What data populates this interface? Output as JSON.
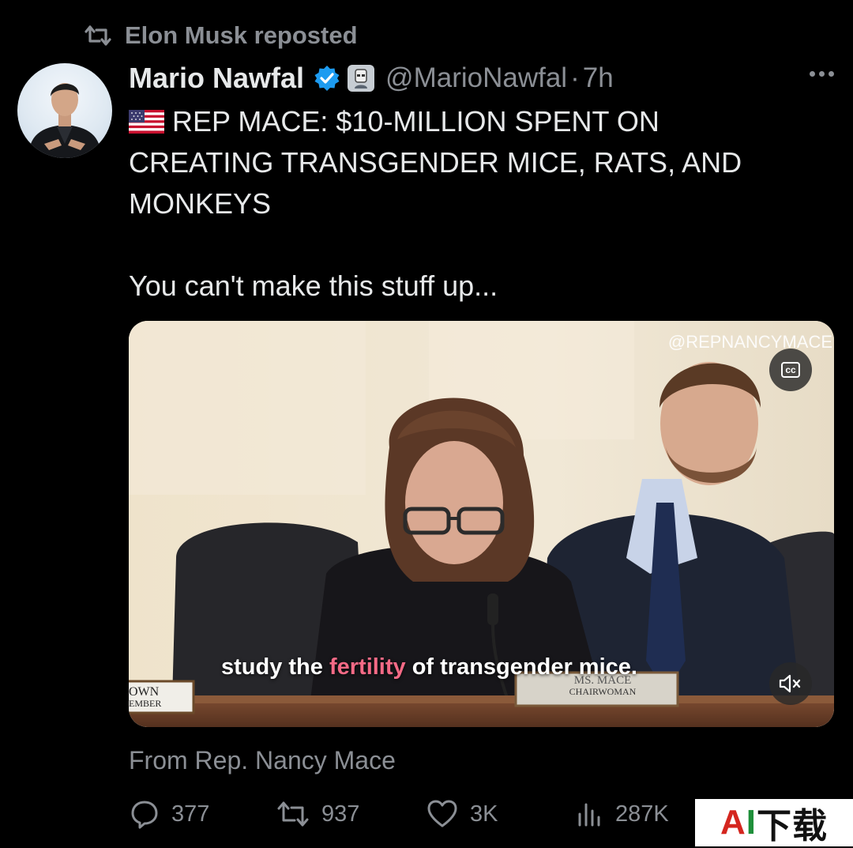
{
  "repost": {
    "label": "Elon Musk reposted",
    "icon": "repost-icon"
  },
  "tweet": {
    "author_name": "Mario Nawfal",
    "handle": "@MarioNawfal",
    "separator": "·",
    "time": "7h",
    "verified_icon": "verified-badge-icon",
    "flag_icon": "us-flag-icon",
    "headline_line_1": "REP MACE: $10-MILLION SPENT ON",
    "headline_line_2": "CREATING TRANSGENDER MICE, RATS, AND",
    "headline_line_3": "MONKEYS",
    "subtext": "You can't make this stuff up...",
    "from_line": "From Rep. Nancy Mace"
  },
  "video": {
    "watermark": "@REPNANCYMACE",
    "cc_label": "cc",
    "caption_before": "study the ",
    "caption_highlight": "fertility",
    "caption_after": " of transgender mice.",
    "placard_left_line_1": "OWN",
    "placard_left_line_2": "EMBER",
    "placard_center_line_1": "MS. MACE",
    "placard_center_line_2": "CHAIRWOMAN"
  },
  "actions": {
    "replies": "377",
    "reposts": "937",
    "likes": "3K",
    "views": "287K"
  },
  "brand": {
    "a": "A",
    "i": "I",
    "rest": "下载"
  },
  "colors": {
    "background": "#000000",
    "text_primary": "#e7e9ea",
    "text_secondary": "#8b8f95",
    "verified_blue": "#1d9bf0",
    "caption_highlight": "#f46a86"
  }
}
